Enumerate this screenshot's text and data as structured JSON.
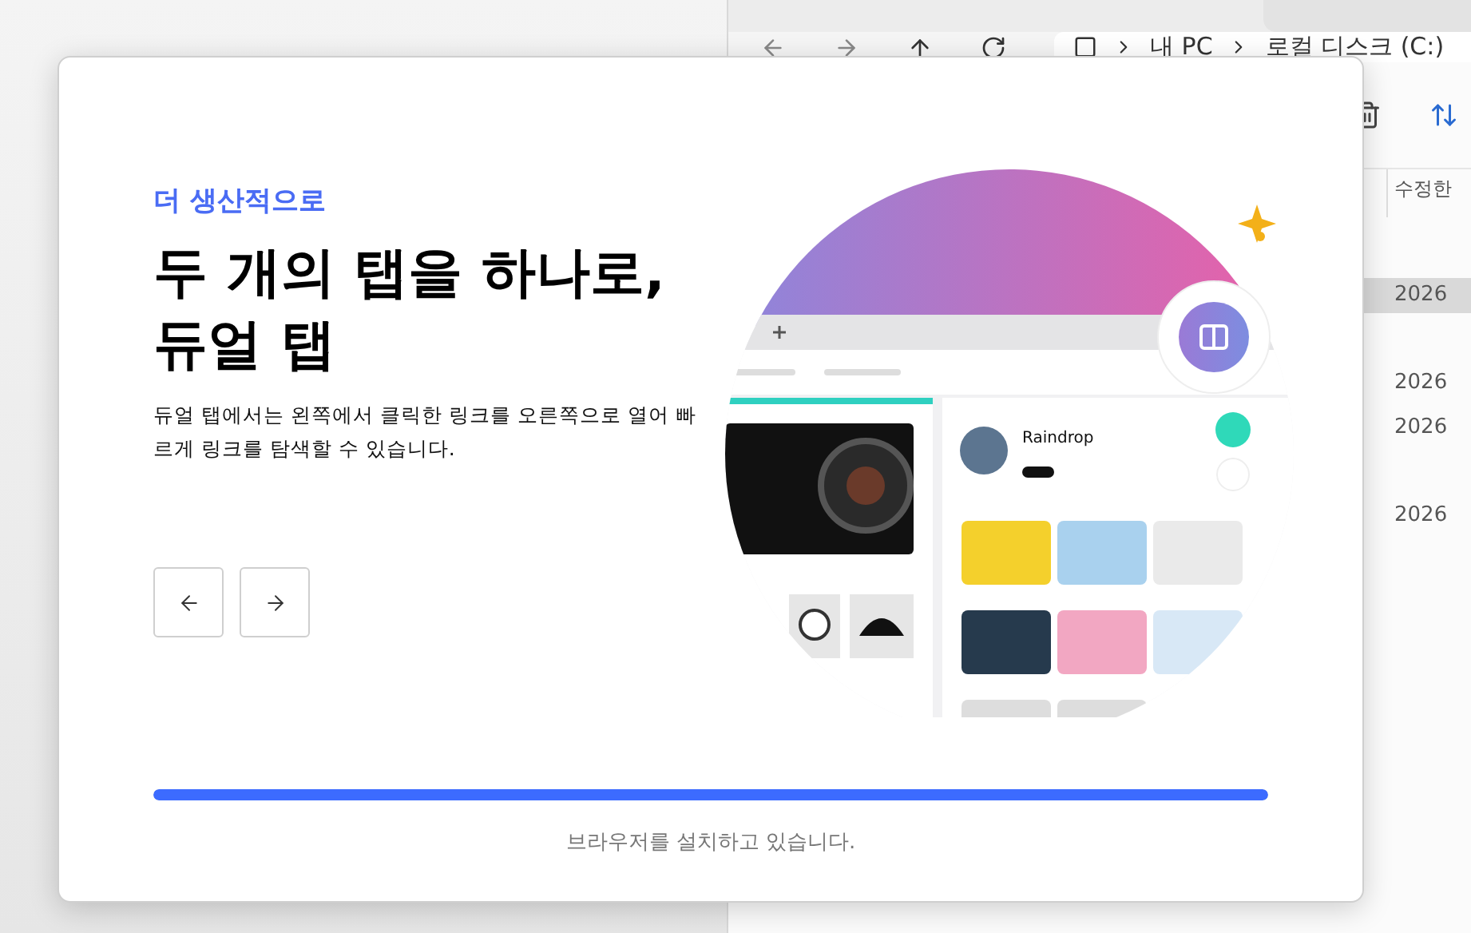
{
  "explorer": {
    "breadcrumb": [
      "내 PC",
      "로컬 디스크 (C:)"
    ],
    "column_header": "수정한",
    "rows": [
      {
        "date": "2026",
        "selected": true
      },
      {
        "date": "2026",
        "selected": false
      },
      {
        "date": "2026",
        "selected": false
      },
      {
        "date": "2026",
        "selected": false
      }
    ]
  },
  "dialog": {
    "eyebrow": "더 생산적으로",
    "title_lines": [
      "두 개의 탭을 하나로,",
      "듀얼 탭"
    ],
    "description": "듀얼 탭에서는 왼쪽에서 클릭한 링크를 오른쪽으로 열어 빠르게 링크를 탐색할 수 있습니다.",
    "illustration": {
      "profile_name": "Raindrop"
    },
    "progress": {
      "level": 1
    },
    "status": "브라우저를 설치하고 있습니다."
  }
}
